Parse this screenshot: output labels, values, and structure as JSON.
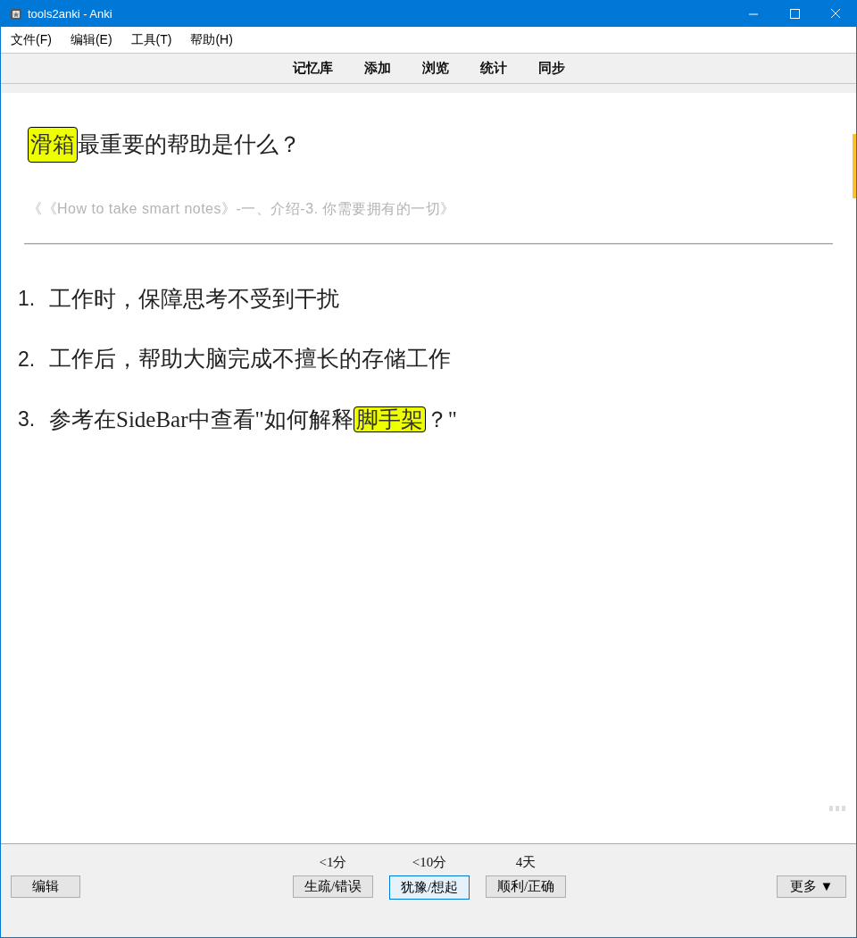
{
  "window": {
    "title": "tools2anki - Anki"
  },
  "menu": [
    "文件(F)",
    "编辑(E)",
    "工具(T)",
    "帮助(H)"
  ],
  "toolbar": [
    "记忆库",
    "添加",
    "浏览",
    "统计",
    "同步"
  ],
  "card": {
    "question": [
      {
        "text": "滑箱",
        "highlight": true
      },
      {
        "text": "最重要的帮助是什么？",
        "highlight": false
      }
    ],
    "source": "《《How to take smart notes》-一、介绍-3. 你需要拥有的一切》",
    "answers": [
      {
        "number": "1.",
        "segments": [
          {
            "text": "工作时，保障思考不受到干扰",
            "highlight": false
          }
        ]
      },
      {
        "number": "2.",
        "segments": [
          {
            "text": "工作后，帮助大脑完成不擅长的存储工作",
            "highlight": false
          }
        ]
      },
      {
        "number": "3.",
        "segments": [
          {
            "text": "参考在SideBar中查看\"如何解释",
            "highlight": false
          },
          {
            "text": "脚手架",
            "highlight": true
          },
          {
            "text": "？\"",
            "highlight": false
          }
        ]
      }
    ]
  },
  "bottom": {
    "edit": "编辑",
    "answers": [
      {
        "interval": "<1分",
        "label": "生疏/错误",
        "focused": false
      },
      {
        "interval": "<10分",
        "label": "犹豫/想起",
        "focused": true
      },
      {
        "interval": "4天",
        "label": "顺利/正确",
        "focused": false
      }
    ],
    "more": "更多 ▼"
  }
}
